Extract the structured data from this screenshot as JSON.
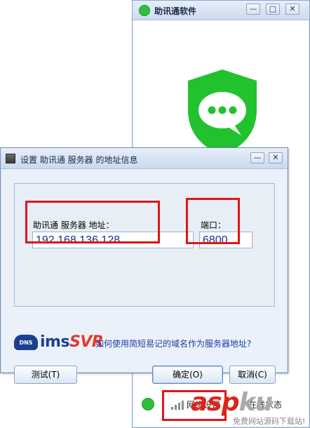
{
  "main_window": {
    "title": "助讯通软件",
    "min_glyph": "—",
    "max_glyph": "□",
    "close_glyph": "✕",
    "status": {
      "network_settings": "网络设置",
      "online_status": "在线状态"
    }
  },
  "dialog": {
    "title": "设置 助讯通 服务器 的地址信息",
    "address_label": "助讯通 服务器 地址：",
    "address_value": "192.168.136.128",
    "port_label": "端口：",
    "port_value": "6800",
    "logo": {
      "dns": "DNS",
      "ims": "ims",
      "svr": "SVR"
    },
    "help_link": "如何使用简短易记的域名作为服务器地址?",
    "buttons": {
      "test": "测试(T)",
      "ok": "确定(O)",
      "cancel": "取消(C)"
    }
  },
  "watermark": {
    "asp": "asp",
    "ku": "ku",
    "sub": "免费网站源码下载站!"
  },
  "colors": {
    "highlight": "#e01616",
    "brand_green": "#2fbf3a",
    "link_blue": "#1f3da0",
    "logo_blue": "#1d3f8f"
  }
}
